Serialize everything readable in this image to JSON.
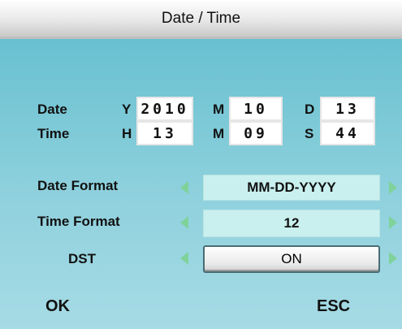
{
  "title": "Date / Time",
  "date": {
    "label": "Date",
    "year_label": "Y",
    "year": "2010",
    "month_label": "M",
    "month": "10",
    "day_label": "D",
    "day": "13"
  },
  "time": {
    "label": "Time",
    "hour_label": "H",
    "hour": "13",
    "minute_label": "M",
    "minute": "09",
    "second_label": "S",
    "second": "44"
  },
  "settings": {
    "date_format_label": "Date Format",
    "date_format_value": "MM-DD-YYYY",
    "time_format_label": "Time Format",
    "time_format_value": "12",
    "dst_label": "DST",
    "dst_value": "ON"
  },
  "footer": {
    "ok": "OK",
    "esc": "ESC"
  },
  "colors": {
    "background": "#8fd1dd",
    "arrow": "#7fd29a",
    "selection": "#c9f0ee"
  },
  "icons": {
    "decrement": "left-arrow-icon",
    "increment": "right-arrow-icon"
  }
}
